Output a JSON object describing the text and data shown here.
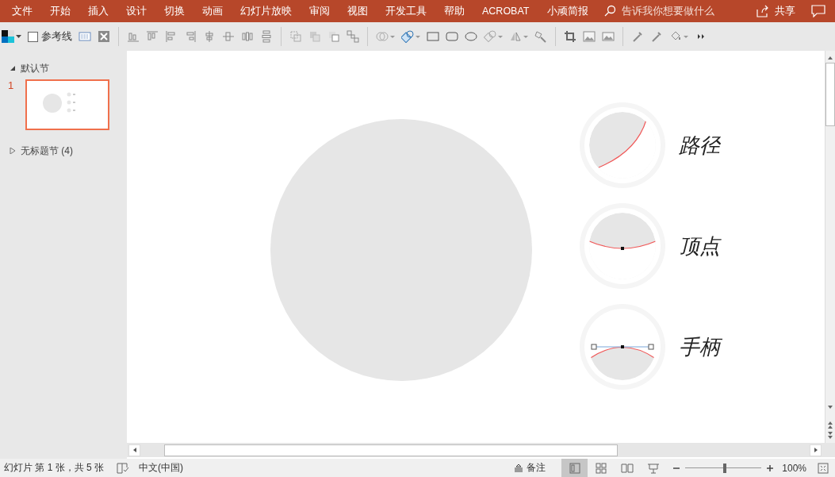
{
  "ribbon_tabs": [
    "文件",
    "开始",
    "插入",
    "设计",
    "切换",
    "动画",
    "幻灯片放映",
    "审阅",
    "视图",
    "开发工具",
    "帮助",
    "ACROBAT",
    "小顽简报"
  ],
  "search": {
    "placeholder": "告诉我你想要做什么"
  },
  "share_button": {
    "label": "共享"
  },
  "toolbar": {
    "guides_checkbox": {
      "label": "参考线",
      "checked": false
    }
  },
  "sidebar": {
    "sections": [
      {
        "title": "默认节",
        "expanded": true,
        "slides": [
          {
            "number": "1",
            "selected": true
          }
        ]
      },
      {
        "title": "无标题节 (4)",
        "expanded": false
      }
    ]
  },
  "slide": {
    "items": [
      {
        "kind": "path",
        "label": "路径"
      },
      {
        "kind": "vertex",
        "label": "顶点"
      },
      {
        "kind": "handle",
        "label": "手柄"
      }
    ]
  },
  "status_bar": {
    "slide_info": "幻灯片 第 1 张，共 5 张",
    "language": "中文(中国)",
    "notes_button": "备注",
    "views": [
      {
        "selected": true
      },
      {
        "selected": false
      },
      {
        "selected": false
      },
      {
        "selected": false
      }
    ],
    "zoom": {
      "level": 0.52,
      "reading": "100%"
    }
  }
}
